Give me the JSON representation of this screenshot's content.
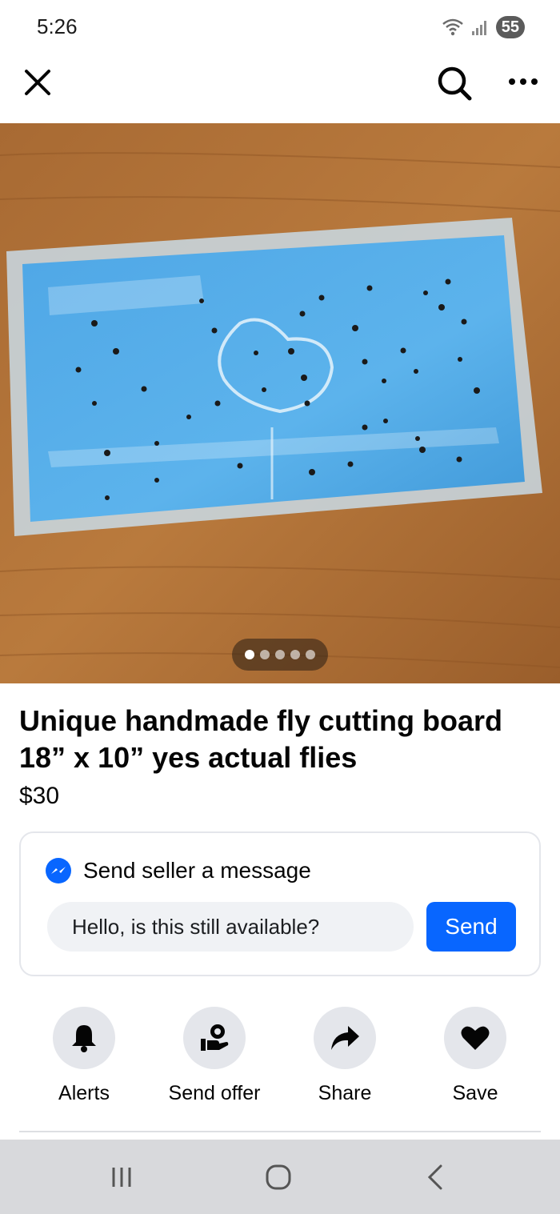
{
  "status_bar": {
    "time": "5:26",
    "battery": "55",
    "icons": [
      "wifi-icon",
      "signal-icon",
      "battery-icon"
    ]
  },
  "top_bar": {
    "icons": [
      "close-icon",
      "search-icon",
      "more-icon"
    ]
  },
  "photo": {
    "carousel_total": 5,
    "carousel_index": 1
  },
  "listing": {
    "title": "Unique handmade fly cutting board 18” x 10” yes actual flies",
    "price": "$30"
  },
  "message_card": {
    "icon": "messenger-icon",
    "title": "Send seller a message",
    "input_value": "Hello, is this still available?",
    "send_label": "Send"
  },
  "actions": [
    {
      "label": "Alerts",
      "icon": "bell-icon"
    },
    {
      "label": "Send offer",
      "icon": "offer-icon"
    },
    {
      "label": "Share",
      "icon": "share-icon"
    },
    {
      "label": "Save",
      "icon": "heart-icon"
    }
  ],
  "nav_bar": {
    "icons": [
      "recent-apps-icon",
      "home-icon",
      "back-icon"
    ]
  },
  "colors": {
    "accent": "#0866ff",
    "circle_bg": "#e4e6eb",
    "input_bg": "#f0f2f5",
    "nav_bg": "#d8d9dc"
  }
}
